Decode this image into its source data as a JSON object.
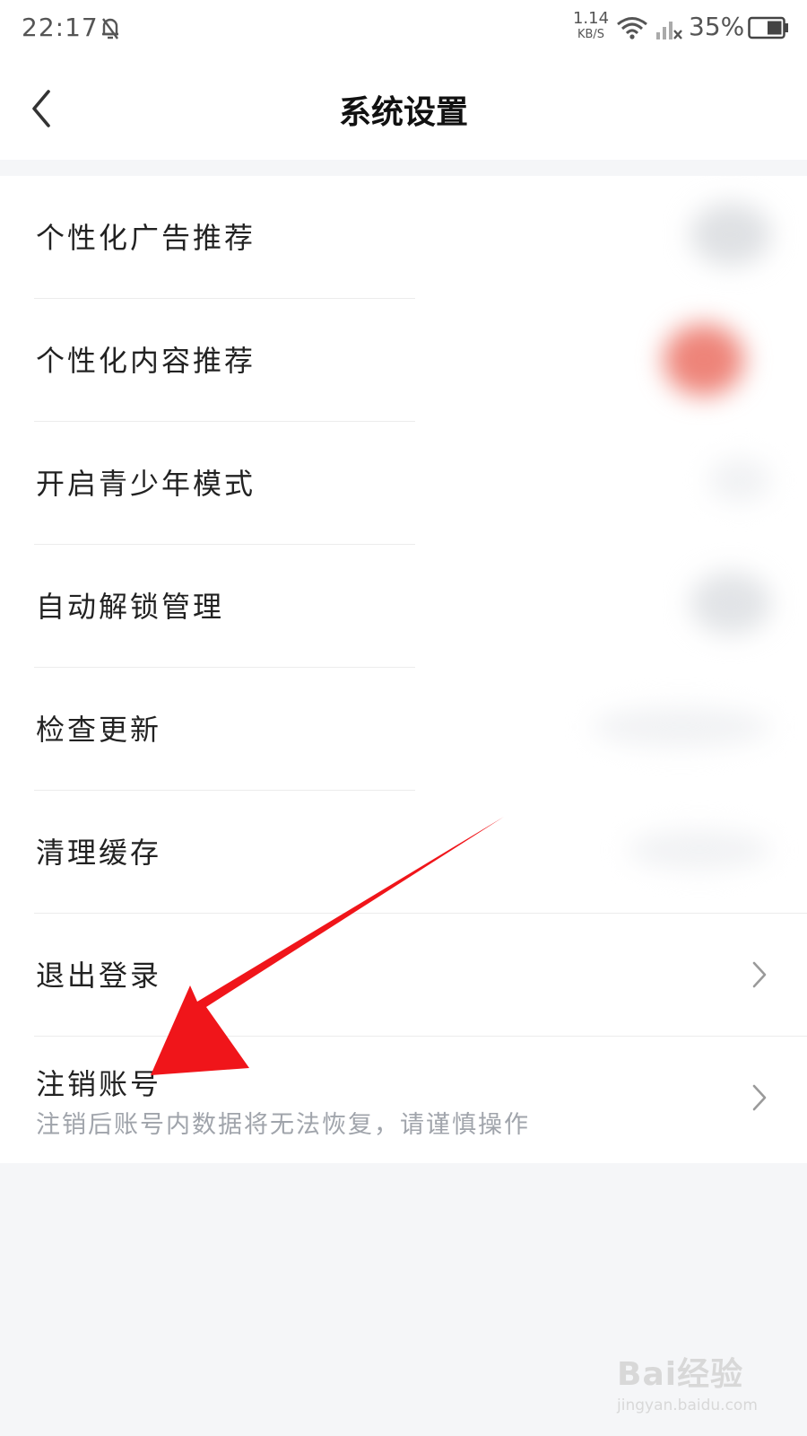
{
  "status_bar": {
    "time": "22:17",
    "net_speed_value": "1.14",
    "net_speed_unit": "KB/S",
    "battery_percent": "35%"
  },
  "header": {
    "title": "系统设置",
    "back_icon": "chevron-left-icon"
  },
  "settings": {
    "items": [
      {
        "label": "个性化广告推荐",
        "control": "toggle-off"
      },
      {
        "label": "个性化内容推荐",
        "control": "toggle-on"
      },
      {
        "label": "开启青少年模式",
        "control": "blurred-value"
      },
      {
        "label": "自动解锁管理",
        "control": "toggle-off"
      },
      {
        "label": "检查更新",
        "control": "blurred-value"
      },
      {
        "label": "清理缓存",
        "control": "blurred-value"
      },
      {
        "label": "退出登录",
        "control": "chevron-right-icon"
      },
      {
        "label": "注销账号",
        "sublabel": "注销后账号内数据将无法恢复，请谨慎操作",
        "control": "chevron-right-icon"
      }
    ]
  },
  "annotation": {
    "arrow_color": "#f0151a"
  },
  "watermark": {
    "logo": "Bai经验",
    "url": "jingyan.baidu.com"
  },
  "colors": {
    "toggle_on": "#f08a80",
    "secondary_text": "#a0a4ab",
    "page_bg": "#f5f6f8"
  }
}
